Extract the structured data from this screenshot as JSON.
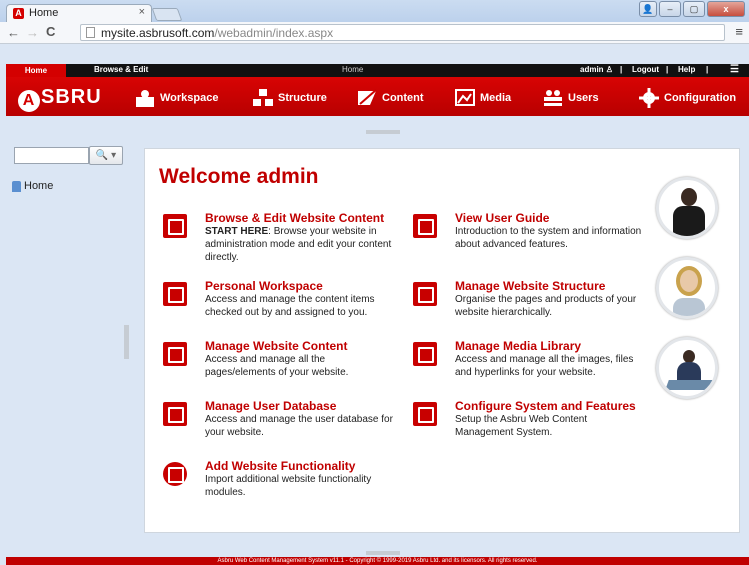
{
  "browser": {
    "tab_title": "Home",
    "tab_close": "×",
    "url_host": "mysite.asbrusoft.com",
    "url_path": "/webadmin/index.aspx",
    "window_buttons": [
      "👤",
      "–",
      "▢",
      "x"
    ]
  },
  "topbar": {
    "home": "Home",
    "browse_edit": "Browse & Edit",
    "centre": "Home",
    "user": "admin ♙",
    "logout": "Logout",
    "help": "Help",
    "separator": "|",
    "menu": "☰"
  },
  "mainbar": {
    "logo": "SBRU",
    "logo_letter": "A",
    "items": [
      "Workspace",
      "Structure",
      "Content",
      "Media",
      "Users",
      "Configuration"
    ]
  },
  "sidebar": {
    "search_placeholder": "",
    "search_button": "🔍 ▾",
    "tree_root": "Home"
  },
  "main": {
    "welcome": "Welcome admin",
    "features": [
      {
        "title": "Browse & Edit Website Content",
        "lead": "START HERE",
        "desc": ": Browse your website in administration mode and edit your content directly."
      },
      {
        "title": "View User Guide",
        "lead": "",
        "desc": "Introduction to the system and information about advanced features."
      },
      {
        "title": "Personal Workspace",
        "lead": "",
        "desc": "Access and manage the content items checked out by and assigned to you."
      },
      {
        "title": "Manage Website Structure",
        "lead": "",
        "desc": "Organise the pages and products of your website hierarchically."
      },
      {
        "title": "Manage Website Content",
        "lead": "",
        "desc": "Access and manage all the pages/elements of your website."
      },
      {
        "title": "Manage Media Library",
        "lead": "",
        "desc": "Access and manage all the images, files and hyperlinks for your website."
      },
      {
        "title": "Manage User Database",
        "lead": "",
        "desc": "Access and manage the user database for your website."
      },
      {
        "title": "Configure System and Features",
        "lead": "",
        "desc": "Setup the Asbru Web Content Management System."
      },
      {
        "title": "Add Website Functionality",
        "lead": "",
        "desc": "Import additional website functionality modules."
      }
    ]
  },
  "footer": {
    "text": "Asbru Web Content Management System v11.1 - Copyright © 1999-2019 Asbru Ltd. and its licensors. All rights reserved."
  },
  "colors": {
    "brand_red": "#c80000",
    "topbar_black": "#111111",
    "chrome_blue": "#cbdcf1"
  }
}
